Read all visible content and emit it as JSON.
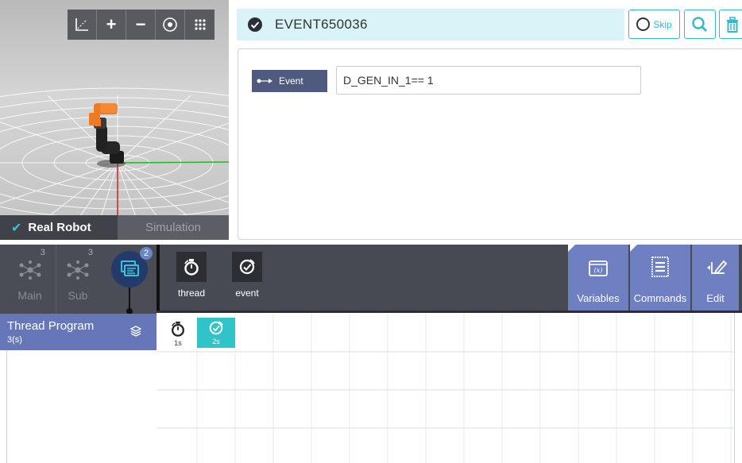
{
  "viewer": {
    "toolbar": [
      "axis-icon",
      "zoom-in-icon",
      "zoom-out-icon",
      "view-icon",
      "grid-dots-icon"
    ],
    "tab_real": "Real Robot",
    "tab_sim": "Simulation"
  },
  "header": {
    "title": "EVENT650036",
    "skip_label": "Skip"
  },
  "property": {
    "tag_label": "Event",
    "condition_value": "D_GEN_IN_1== 1"
  },
  "program_tabs": {
    "main_label": "Main",
    "main_count": "3",
    "sub_label": "Sub",
    "sub_count": "3",
    "thread_count": "2"
  },
  "thread_program": {
    "name": "Thread Program",
    "duration": "3(s)"
  },
  "commands": {
    "thread_label": "thread",
    "event_label": "event"
  },
  "tools": {
    "variables_label": "Variables",
    "commands_label": "Commands",
    "edit_label": "Edit"
  },
  "timeline": {
    "thread_duration": "1s",
    "event_duration": "2s"
  },
  "colors": {
    "accent": "#35b9cc",
    "header_bg": "#d9f3f8",
    "thread_blue": "#6577b8",
    "event_teal": "#2ec4c8",
    "robot_orange": "#f07a22"
  }
}
